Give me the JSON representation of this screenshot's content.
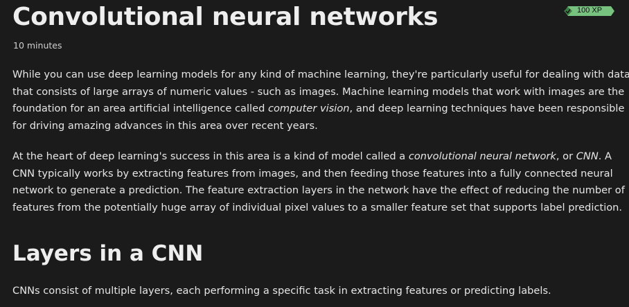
{
  "header": {
    "title": "Convolutional neural networks",
    "duration": "10 minutes",
    "xp_badge": "100 XP",
    "badge_icon": "check-icon",
    "badge_color": "#78c27f"
  },
  "paragraphs": [
    {
      "lines": [
        [
          {
            "t": "While you can use deep learning models for any kind of machine learning, they're particularly useful for dealing with data"
          }
        ],
        [
          {
            "t": "that consists of large arrays of numeric values - such as images. Machine learning models that work with images are the"
          }
        ],
        [
          {
            "t": "foundation for an area artificial intelligence called "
          },
          {
            "t": "computer vision",
            "i": true
          },
          {
            "t": ", and deep learning techniques have been responsible"
          }
        ],
        [
          {
            "t": "for driving amazing advances in this area over recent years."
          }
        ]
      ]
    },
    {
      "lines": [
        [
          {
            "t": "At the heart of deep learning's success in this area is a kind of model called a "
          },
          {
            "t": "convolutional neural network",
            "i": true
          },
          {
            "t": ", or "
          },
          {
            "t": "CNN",
            "i": true
          },
          {
            "t": ". A"
          }
        ],
        [
          {
            "t": "CNN typically works by extracting features from images, and then feeding those features into a fully connected neural"
          }
        ],
        [
          {
            "t": "network to generate a prediction. The feature extraction layers in the network have the effect of reducing the number of"
          }
        ],
        [
          {
            "t": "features from the potentially huge array of individual pixel values to a smaller feature set that supports label prediction."
          }
        ]
      ]
    }
  ],
  "section": {
    "heading": "Layers in a CNN",
    "text": "CNNs consist of multiple layers, each performing a specific task in extracting features or predicting labels."
  }
}
